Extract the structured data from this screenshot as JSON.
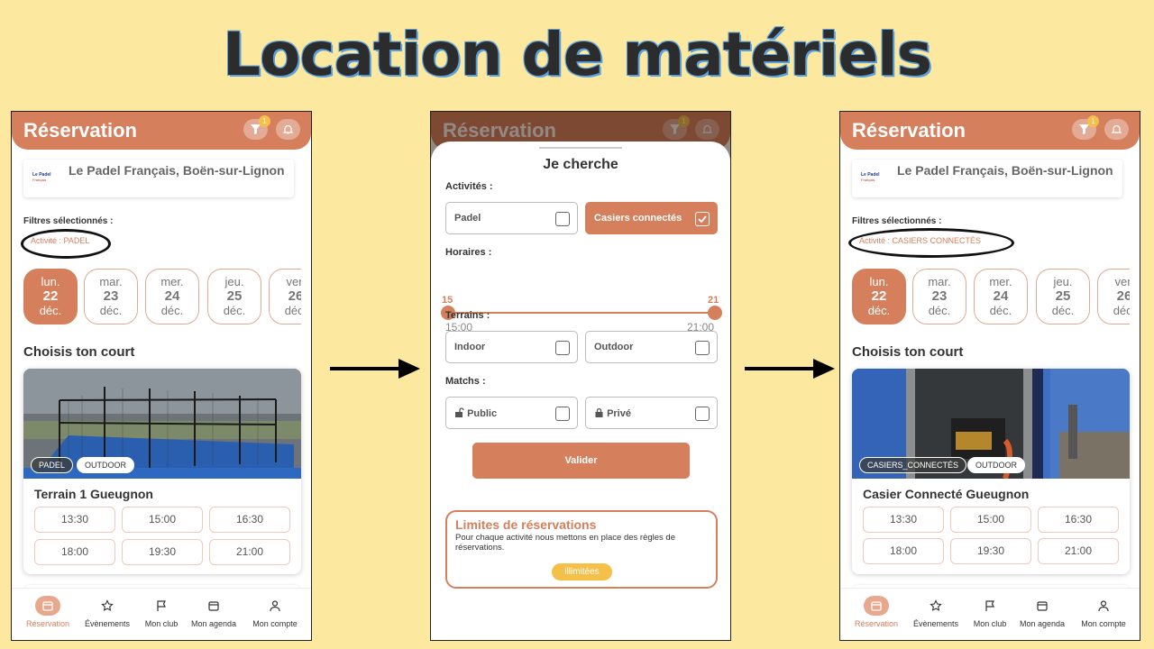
{
  "slide_title": "Location de matériels",
  "header_title": "Réservation",
  "filter_badge": "1",
  "club_name": "Le Padel Français, Boën-sur-Lignon",
  "club_logo_text": [
    "Le Padel",
    "Français"
  ],
  "filters_label": "Filtres sélectionnés :",
  "phone1_filter": "Activité : PADEL",
  "phone3_filter": "Activité : CASIERS CONNECTÉS",
  "days": [
    {
      "dow": "lun.",
      "num": "22",
      "month": "déc.",
      "selected": true
    },
    {
      "dow": "mar.",
      "num": "23",
      "month": "déc.",
      "selected": false
    },
    {
      "dow": "mer.",
      "num": "24",
      "month": "déc.",
      "selected": false
    },
    {
      "dow": "jeu.",
      "num": "25",
      "month": "déc.",
      "selected": false
    },
    {
      "dow": "ven",
      "num": "26",
      "month": "déc.",
      "selected": false
    }
  ],
  "section_title": "Choisis ton court",
  "card1": {
    "tags": [
      "PADEL",
      "OUTDOOR"
    ],
    "name": "Terrain 1 Gueugnon"
  },
  "card3": {
    "tags": [
      "CASIERS_CONNECTÉS",
      "OUTDOOR"
    ],
    "name": "Casier Connecté Gueugnon"
  },
  "slots": [
    "13:30",
    "15:00",
    "16:30",
    "18:00",
    "19:30",
    "21:00"
  ],
  "nav": [
    "Réservation",
    "Évènements",
    "Mon club",
    "Mon agenda",
    "Mon compte"
  ],
  "sheet": {
    "title": "Je cherche",
    "activities_label": "Activités :",
    "activities": [
      {
        "label": "Padel",
        "checked": false
      },
      {
        "label": "Casiers connectés",
        "checked": true
      }
    ],
    "hours_label": "Horaires :",
    "hours_from": "15",
    "hours_to": "21",
    "hours_min": "15:00",
    "hours_max": "21:00",
    "terrains_label": "Terrains :",
    "terrains": [
      {
        "label": "Indoor",
        "checked": false
      },
      {
        "label": "Outdoor",
        "checked": false
      }
    ],
    "matches_label": "Matchs :",
    "matches": [
      {
        "label": "Public",
        "icon": "unlock-icon",
        "checked": false
      },
      {
        "label": "Privé",
        "icon": "lock-icon",
        "checked": false
      }
    ],
    "validate": "Valider",
    "limits_title": "Limites de réservations",
    "limits_desc": "Pour chaque activité nous mettons en place des règles de réservations.",
    "limits_pill": "illimitées"
  },
  "colors": {
    "accent": "#d57f5c",
    "background": "#fde89f",
    "badge": "#f5c04a"
  }
}
